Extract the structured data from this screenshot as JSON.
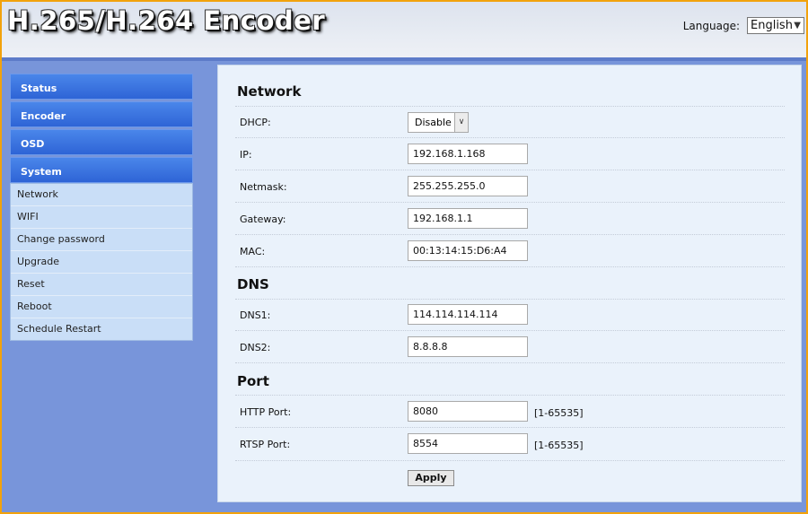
{
  "header": {
    "title": "H.265/H.264 Encoder",
    "language_label": "Language:",
    "language_value": "English"
  },
  "sidebar": {
    "menu": [
      {
        "label": "Status"
      },
      {
        "label": "Encoder"
      },
      {
        "label": "OSD"
      },
      {
        "label": "System"
      }
    ],
    "system_submenu": [
      {
        "label": "Network"
      },
      {
        "label": "WIFI"
      },
      {
        "label": "Change password"
      },
      {
        "label": "Upgrade"
      },
      {
        "label": "Reset"
      },
      {
        "label": "Reboot"
      },
      {
        "label": "Schedule Restart"
      }
    ]
  },
  "network": {
    "title": "Network",
    "dhcp_label": "DHCP:",
    "dhcp_value": "Disable",
    "ip_label": "IP:",
    "ip_value": "192.168.1.168",
    "netmask_label": "Netmask:",
    "netmask_value": "255.255.255.0",
    "gateway_label": "Gateway:",
    "gateway_value": "192.168.1.1",
    "mac_label": "MAC:",
    "mac_value": "00:13:14:15:D6:A4"
  },
  "dns": {
    "title": "DNS",
    "dns1_label": "DNS1:",
    "dns1_value": "114.114.114.114",
    "dns2_label": "DNS2:",
    "dns2_value": "8.8.8.8"
  },
  "port": {
    "title": "Port",
    "http_label": "HTTP Port:",
    "http_value": "8080",
    "http_range": "[1-65535]",
    "rtsp_label": "RTSP Port:",
    "rtsp_value": "8554",
    "rtsp_range": "[1-65535]"
  },
  "actions": {
    "apply_label": "Apply"
  },
  "colors": {
    "frame_border": "#f2a20c",
    "page_background": "#7895da",
    "menu_blue": "#2e64d6",
    "submenu_background": "#c9def7",
    "content_background": "#eaf2fb"
  },
  "icons": {
    "select_arrow": "chevron-down-icon"
  }
}
